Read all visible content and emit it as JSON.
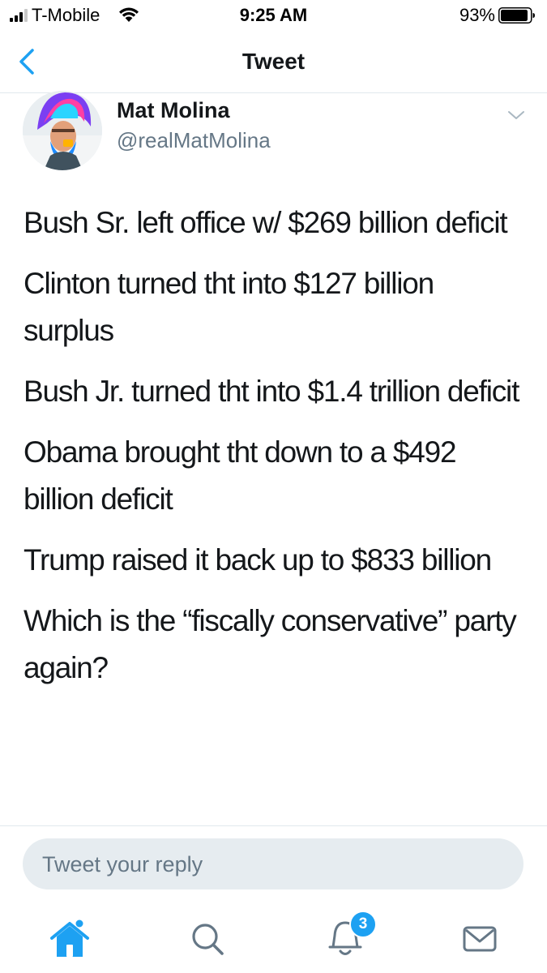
{
  "status_bar": {
    "carrier": "T-Mobile",
    "time": "9:25 AM",
    "battery_percent": "93%",
    "battery_level": 0.93,
    "icons": [
      "signal-icon",
      "wifi-icon",
      "battery-icon"
    ]
  },
  "nav": {
    "title": "Tweet",
    "back_icon": "chevron-left-icon"
  },
  "tweet": {
    "author_name": "Mat Molina",
    "author_handle": "@realMatMolina",
    "menu_icon": "chevron-down-icon",
    "lines": [
      "Bush Sr. left office w/ $269 billion deficit",
      "Clinton turned tht into $127 billion surplus",
      "Bush Jr. turned tht into $1.4 trillion deficit",
      "Obama brought tht down to a $492 billion deficit",
      "Trump raised it back up to $833 billion",
      "Which is the “fiscally conservative” party again?"
    ]
  },
  "reply": {
    "placeholder": "Tweet your reply"
  },
  "tab_bar": {
    "tabs": [
      {
        "name": "home",
        "icon": "home-icon",
        "active": true
      },
      {
        "name": "search",
        "icon": "search-icon",
        "active": false
      },
      {
        "name": "notifications",
        "icon": "bell-icon",
        "active": false
      },
      {
        "name": "messages",
        "icon": "envelope-icon",
        "active": false
      }
    ],
    "notifications_badge": "3"
  },
  "colors": {
    "accent": "#1da1f2",
    "text": "#14171a",
    "secondary_text": "#657786",
    "divider": "#e1e8ed",
    "reply_bg": "#e6ecf0"
  }
}
